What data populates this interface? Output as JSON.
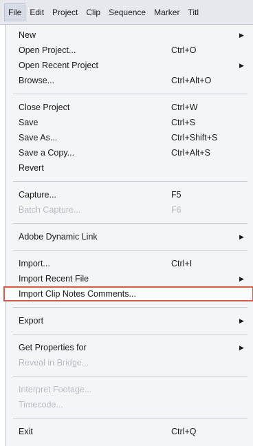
{
  "menubar": {
    "items": [
      "File",
      "Edit",
      "Project",
      "Clip",
      "Sequence",
      "Marker",
      "Titl"
    ]
  },
  "file_menu": {
    "new": {
      "label": "New",
      "arrow": "▶"
    },
    "open_project": {
      "label": "Open Project...",
      "shortcut": "Ctrl+O"
    },
    "open_recent_project": {
      "label": "Open Recent Project",
      "arrow": "▶"
    },
    "browse": {
      "label": "Browse...",
      "shortcut": "Ctrl+Alt+O"
    },
    "close_project": {
      "label": "Close Project",
      "shortcut": "Ctrl+W"
    },
    "save": {
      "label": "Save",
      "shortcut": "Ctrl+S"
    },
    "save_as": {
      "label": "Save As...",
      "shortcut": "Ctrl+Shift+S"
    },
    "save_a_copy": {
      "label": "Save a Copy...",
      "shortcut": "Ctrl+Alt+S"
    },
    "revert": {
      "label": "Revert"
    },
    "capture": {
      "label": "Capture...",
      "shortcut": "F5"
    },
    "batch_capture": {
      "label": "Batch Capture...",
      "shortcut": "F6"
    },
    "adobe_dynamic_link": {
      "label": "Adobe Dynamic Link",
      "arrow": "▶"
    },
    "import": {
      "label": "Import...",
      "shortcut": "Ctrl+I"
    },
    "import_recent_file": {
      "label": "Import Recent File",
      "arrow": "▶"
    },
    "import_clip_notes": {
      "label": "Import Clip Notes Comments..."
    },
    "export": {
      "label": "Export",
      "arrow": "▶"
    },
    "get_properties_for": {
      "label": "Get Properties for",
      "arrow": "▶"
    },
    "reveal_in_bridge": {
      "label": "Reveal in Bridge..."
    },
    "interpret_footage": {
      "label": "Interpret Footage..."
    },
    "timecode": {
      "label": "Timecode..."
    },
    "exit": {
      "label": "Exit",
      "shortcut": "Ctrl+Q"
    }
  },
  "colors": {
    "highlight_outline": "#d9584a",
    "disabled_text": "#b9bdc6"
  }
}
